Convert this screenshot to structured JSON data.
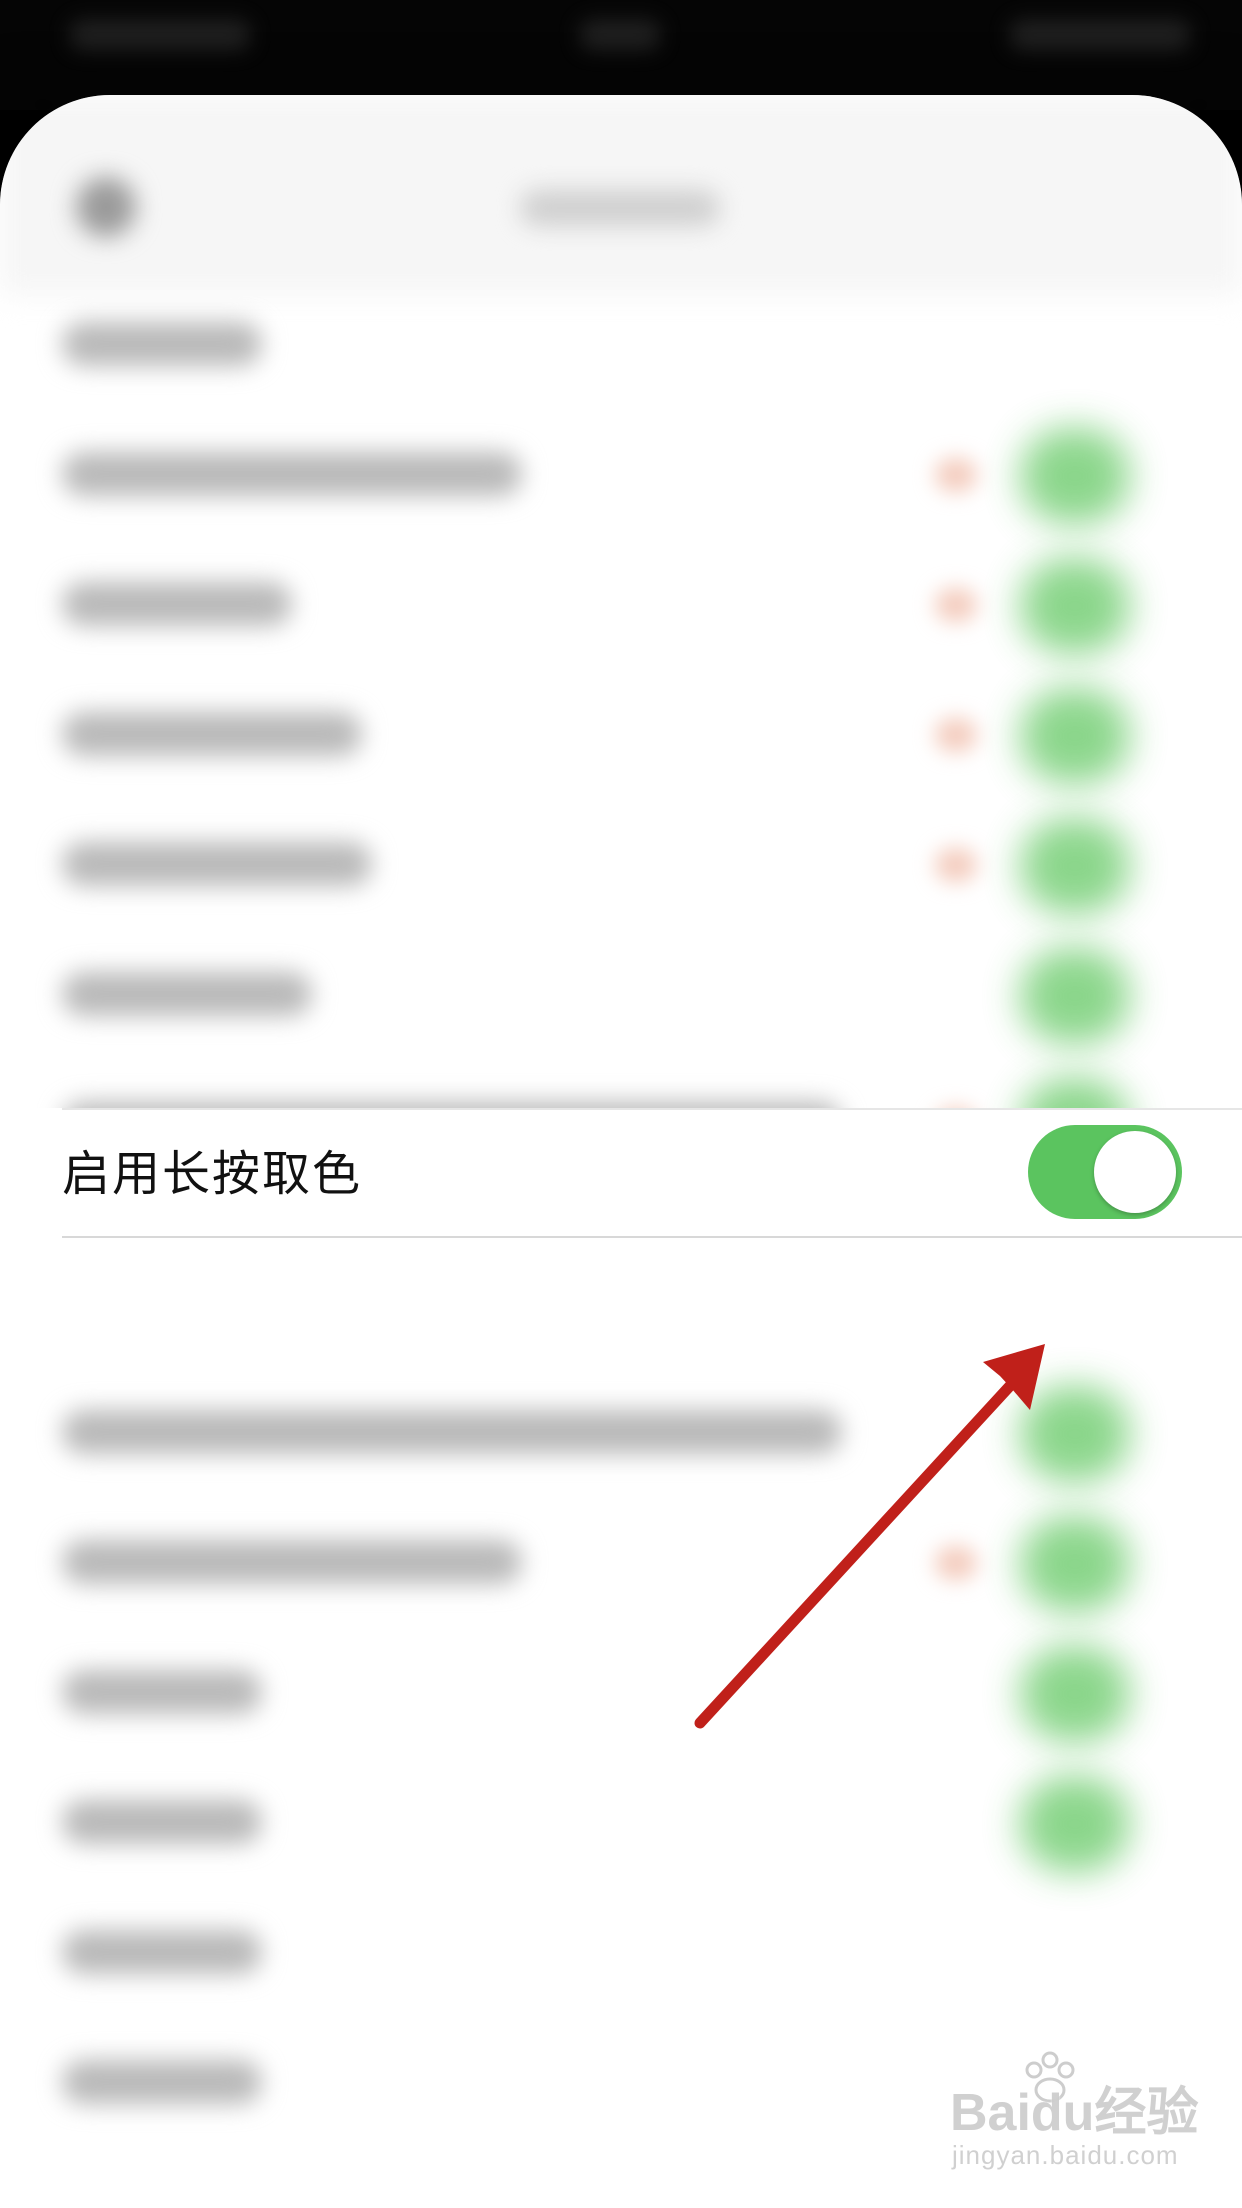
{
  "settings_row": {
    "label": "启用长按取色",
    "toggle_on": true
  },
  "colors": {
    "toggle_green": "#5bc45f",
    "arrow_red": "#c0201a"
  },
  "icons": {
    "back": "back-icon"
  },
  "watermark": {
    "logo_text": "Baidu经验",
    "url": "jingyan.baidu.com"
  }
}
